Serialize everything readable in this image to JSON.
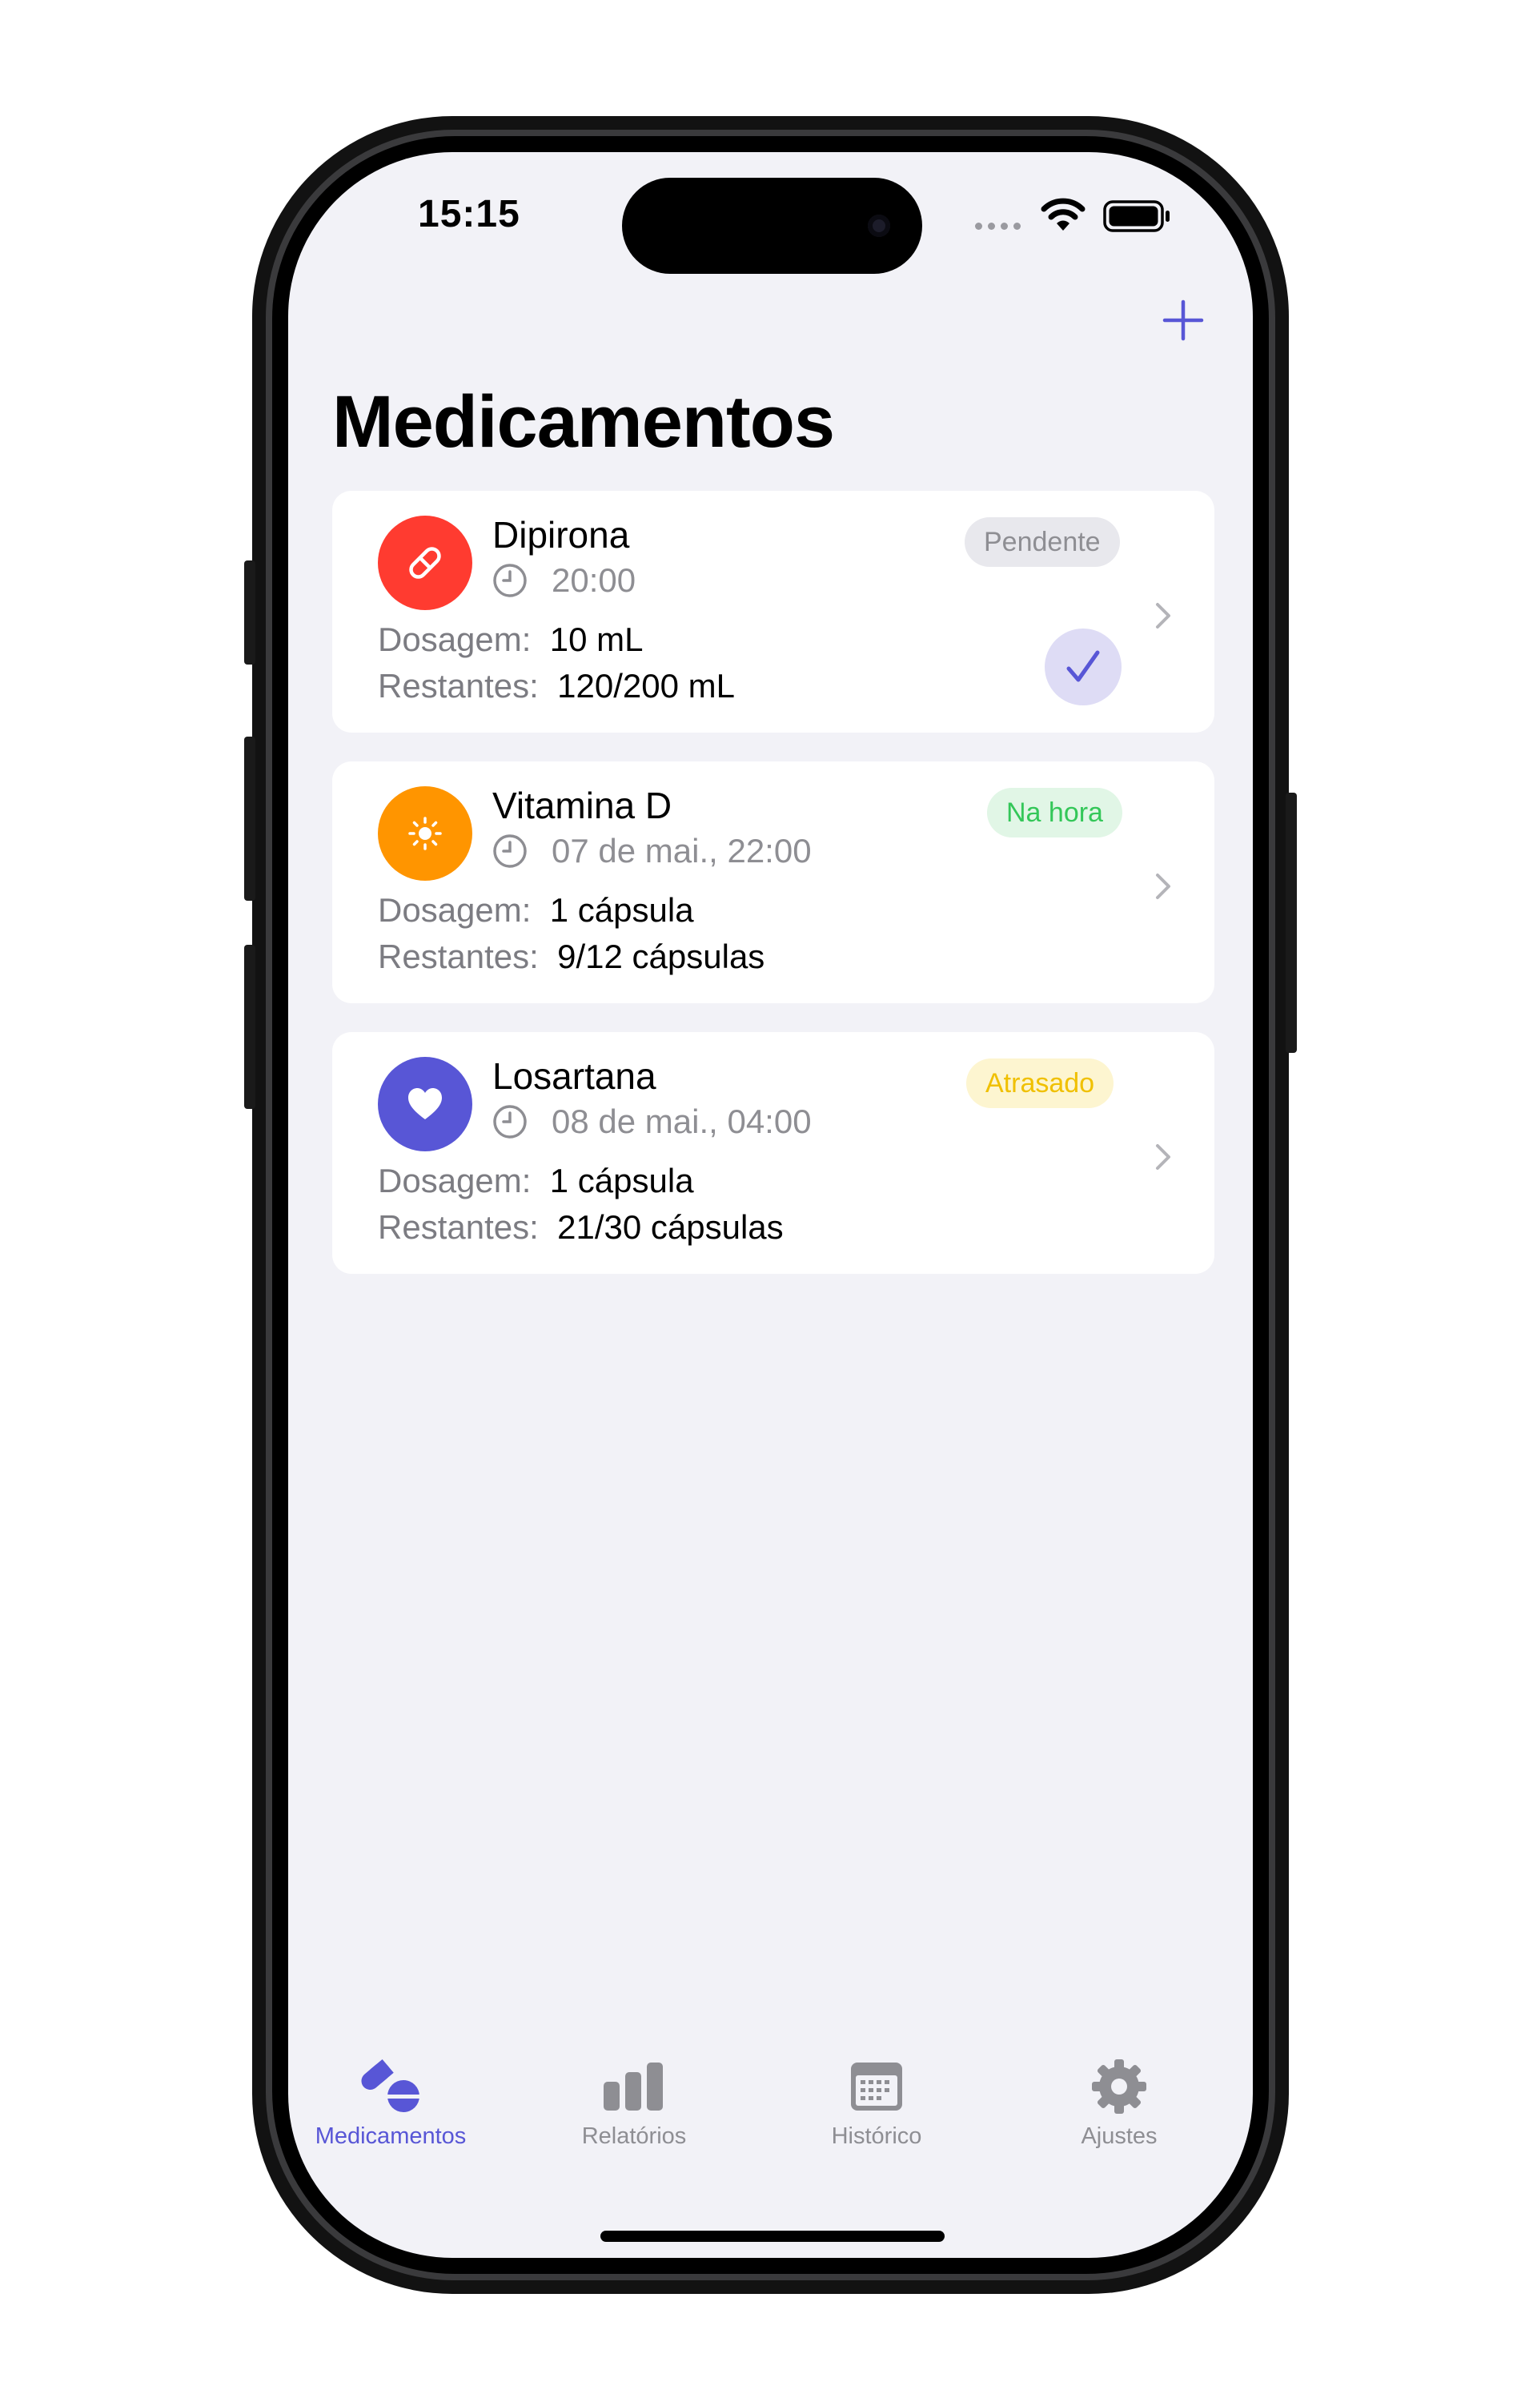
{
  "status_bar": {
    "time": "15:15"
  },
  "nav": {
    "add_icon": "plus-icon"
  },
  "page": {
    "title": "Medicamentos"
  },
  "labels": {
    "dosage": "Dosagem:",
    "remaining": "Restantes:"
  },
  "medications": [
    {
      "name": "Dipirona",
      "icon": "pill-icon",
      "icon_color": "#ff3b30",
      "time": "20:00",
      "dosage": "10 mL",
      "remaining": "120/200 mL",
      "status": "Pendente",
      "status_text_color": "#8e8e93",
      "status_bg_color": "#e8e8ed",
      "show_check": true
    },
    {
      "name": "Vitamina D",
      "icon": "sun-icon",
      "icon_color": "#ff9500",
      "time": "07 de mai., 22:00",
      "dosage": "1 cápsula",
      "remaining": "9/12 cápsulas",
      "status": "Na hora",
      "status_text_color": "#34c759",
      "status_bg_color": "#e1f6e6",
      "show_check": false
    },
    {
      "name": "Losartana",
      "icon": "heart-icon",
      "icon_color": "#5856d6",
      "time": "08 de mai., 04:00",
      "dosage": "1 cápsula",
      "remaining": "21/30 cápsulas",
      "status": "Atrasado",
      "status_text_color": "#ffcc00",
      "status_bg_color": "#fdf5d0",
      "show_check": false
    }
  ],
  "tabbar": {
    "active_color": "#5856d6",
    "inactive_color": "#8e8e93",
    "tabs": [
      {
        "label": "Medicamentos",
        "icon": "pills-icon",
        "active": true
      },
      {
        "label": "Relatórios",
        "icon": "bar-chart-icon",
        "active": false
      },
      {
        "label": "Histórico",
        "icon": "calendar-icon",
        "active": false
      },
      {
        "label": "Ajustes",
        "icon": "gear-icon",
        "active": false
      }
    ]
  }
}
